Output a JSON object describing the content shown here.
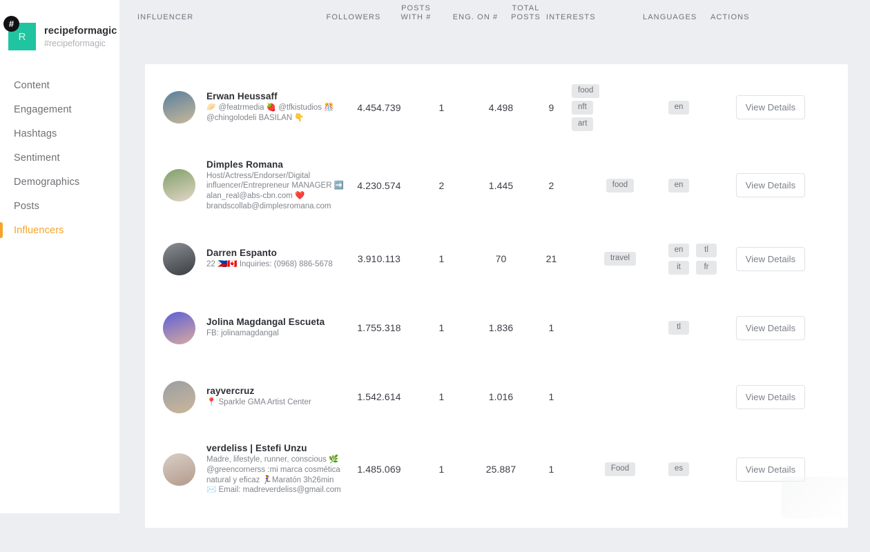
{
  "sidebar": {
    "brand": {
      "hash_icon": "#",
      "avatar_letter": "R",
      "name": "recipeformagic",
      "handle": "#recipeformagic"
    },
    "items": [
      {
        "label": "Content",
        "active": false
      },
      {
        "label": "Engagement",
        "active": false
      },
      {
        "label": "Hashtags",
        "active": false
      },
      {
        "label": "Sentiment",
        "active": false
      },
      {
        "label": "Demographics",
        "active": false
      },
      {
        "label": "Posts",
        "active": false
      },
      {
        "label": "Influencers",
        "active": true
      }
    ],
    "accent_color": "#f6a42a",
    "brand_color": "#20c4a0"
  },
  "table": {
    "columns": [
      {
        "key": "influencer",
        "label": "INFLUENCER"
      },
      {
        "key": "followers",
        "label": "FOLLOWERS"
      },
      {
        "key": "posts_with_hash",
        "label": "POSTS WITH #"
      },
      {
        "key": "eng_on_hash",
        "label": "ENG. ON #"
      },
      {
        "key": "total_posts",
        "label": "TOTAL POSTS"
      },
      {
        "key": "interests",
        "label": "INTERESTS"
      },
      {
        "key": "languages",
        "label": "LANGUAGES"
      },
      {
        "key": "actions",
        "label": "ACTIONS"
      }
    ],
    "action_label": "View Details",
    "rows": [
      {
        "name": "Erwan Heussaff",
        "bio": "🥟 @featrmedia 🍓 @tfkistudios 🎊 @chingolodeli BASILAN 👇",
        "followers": "4.454.739",
        "posts_with_hash": "1",
        "eng_on_hash": "4.498",
        "total_posts": "9",
        "interests": [
          "food",
          "nft",
          "art"
        ],
        "languages": [
          "en"
        ]
      },
      {
        "name": "Dimples Romana",
        "bio": "Host/Actress/Endorser/Digital influencer/Entrepreneur MANAGER ➡️ alan_real@abs-cbn.com ❤️ brandscollab@dimplesromana.com",
        "followers": "4.230.574",
        "posts_with_hash": "2",
        "eng_on_hash": "1.445",
        "total_posts": "2",
        "interests": [
          "food"
        ],
        "languages": [
          "en"
        ]
      },
      {
        "name": "Darren Espanto",
        "bio": "22 🇵🇭🇨🇦 Inquiries: (0968) 886-5678",
        "followers": "3.910.113",
        "posts_with_hash": "1",
        "eng_on_hash": "70",
        "total_posts": "21",
        "interests": [
          "travel"
        ],
        "languages": [
          "en",
          "tl",
          "it",
          "fr"
        ]
      },
      {
        "name": "Jolina Magdangal Escueta",
        "bio": "FB: jolinamagdangal",
        "followers": "1.755.318",
        "posts_with_hash": "1",
        "eng_on_hash": "1.836",
        "total_posts": "1",
        "interests": [],
        "languages": [
          "tl"
        ]
      },
      {
        "name": "rayvercruz",
        "bio": "📍 Sparkle GMA Artist Center",
        "followers": "1.542.614",
        "posts_with_hash": "1",
        "eng_on_hash": "1.016",
        "total_posts": "1",
        "interests": [],
        "languages": []
      },
      {
        "name": "verdeliss | Estefi Unzu",
        "bio": "Madre, lifestyle, runner, conscious 🌿@greencornerss :mi marca cosmética natural y eficaz 🏃‍♀️Maratón 3h26min ✉️ Email: madreverdeliss@gmail.com",
        "followers": "1.485.069",
        "posts_with_hash": "1",
        "eng_on_hash": "25.887",
        "total_posts": "1",
        "interests": [
          "Food"
        ],
        "languages": [
          "es"
        ]
      }
    ]
  }
}
